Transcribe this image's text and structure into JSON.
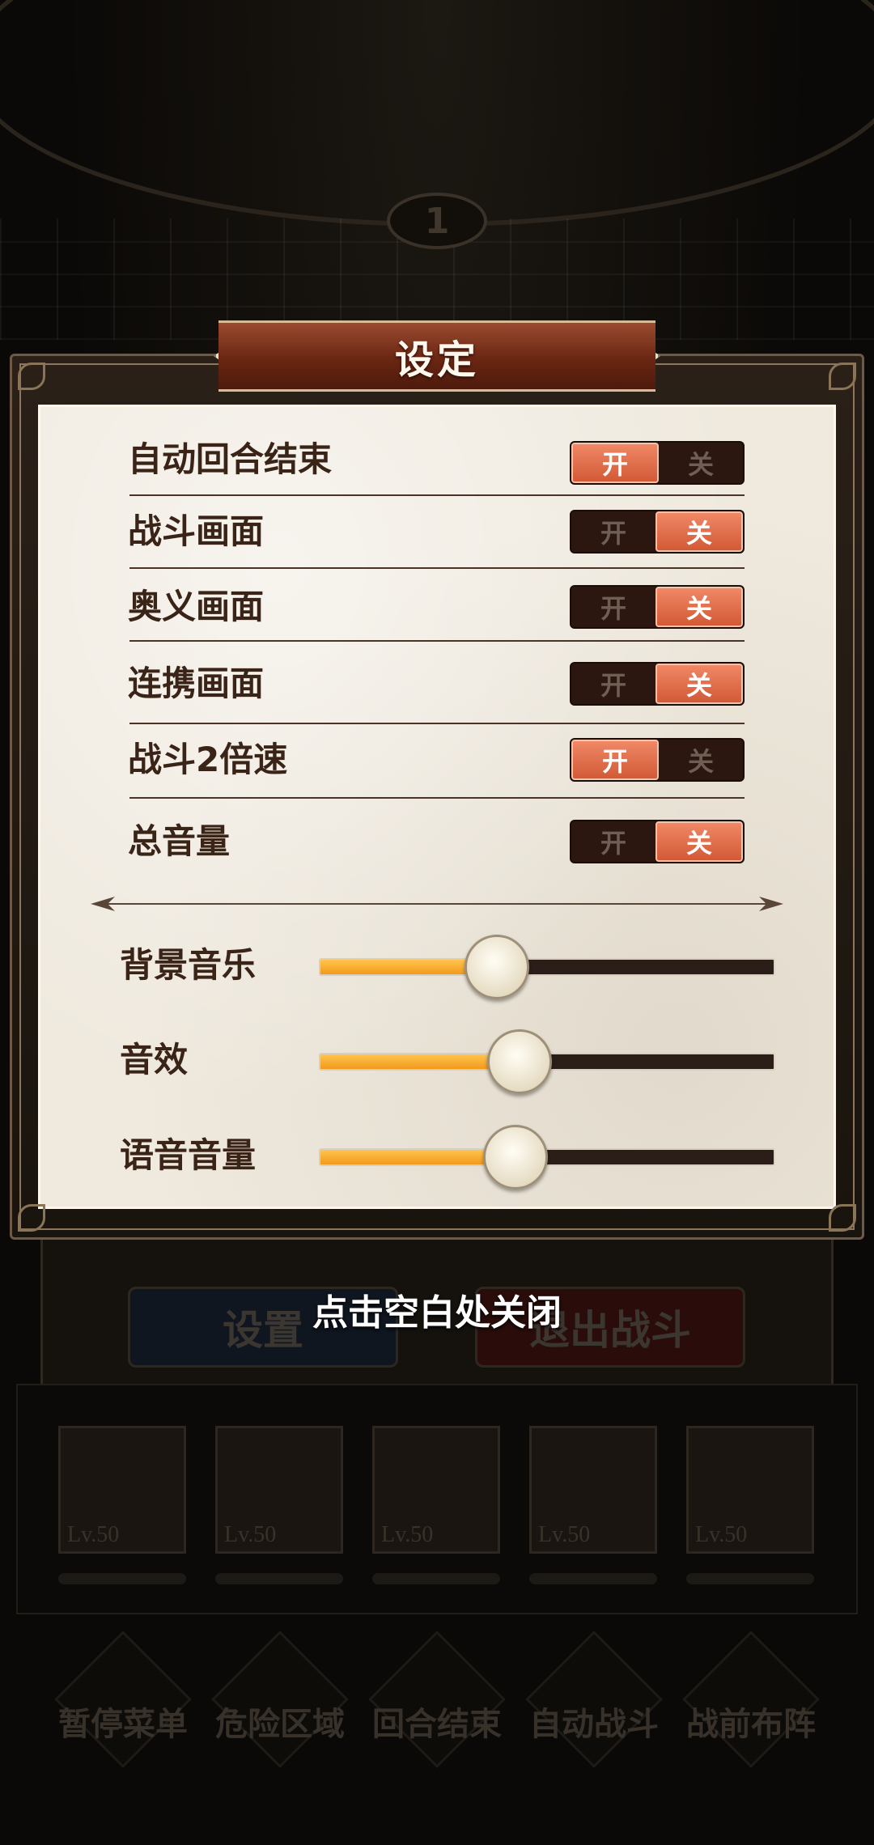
{
  "background": {
    "round_number": "1",
    "lower_buttons": {
      "left": "设置",
      "right": "退出战斗"
    },
    "team_levels": [
      "Lv.50",
      "Lv.50",
      "Lv.50",
      "Lv.50",
      "Lv.50"
    ],
    "menu_items": [
      "暂停菜单",
      "危险区域",
      "回合结束",
      "自动战斗",
      "战前布阵"
    ]
  },
  "dialog": {
    "title": "设定",
    "toggles": [
      {
        "label": "自动回合结束",
        "on_text": "开",
        "off_text": "关",
        "state": "on"
      },
      {
        "label": "战斗画面",
        "on_text": "开",
        "off_text": "关",
        "state": "off"
      },
      {
        "label": "奥义画面",
        "on_text": "开",
        "off_text": "关",
        "state": "off"
      },
      {
        "label": "连携画面",
        "on_text": "开",
        "off_text": "关",
        "state": "off"
      },
      {
        "label": "战斗2倍速",
        "on_text": "开",
        "off_text": "关",
        "state": "on"
      },
      {
        "label": "总音量",
        "on_text": "开",
        "off_text": "关",
        "state": "off"
      }
    ],
    "sliders": [
      {
        "label": "背景音乐",
        "level": 0.39
      },
      {
        "label": "音效",
        "level": 0.44
      },
      {
        "label": "语音音量",
        "level": 0.43
      }
    ]
  },
  "close_hint": "点击空白处关闭",
  "colors": {
    "toggle_active": "#e06d46",
    "toggle_inactive": "#2c1610",
    "slider_fill": "#f5a623",
    "title_banner": "#7a2e18",
    "paper": "#efe9de"
  }
}
